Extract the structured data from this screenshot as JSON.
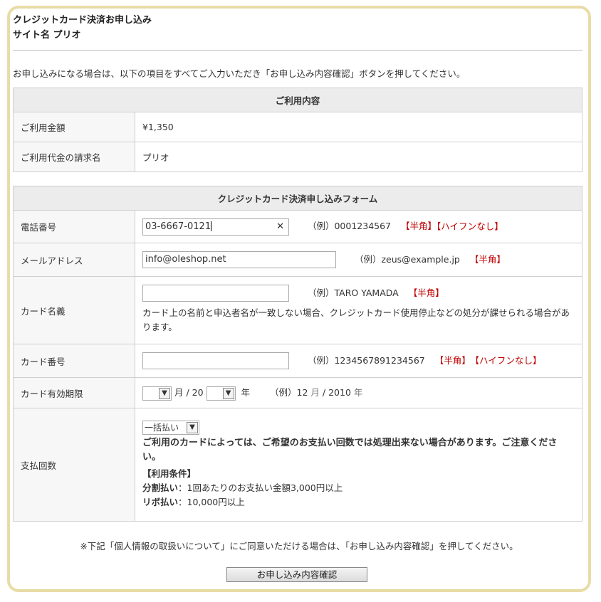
{
  "header": {
    "title": "クレジットカード決済お申し込み",
    "site": "サイト名 プリオ"
  },
  "intro": "お申し込みになる場合は、以下の項目をすべてご入力いただき「お申し込み内容確認」ボタンを押してください。",
  "usage": {
    "heading": "ご利用内容",
    "rows": [
      {
        "label": "ご利用金額",
        "value": "¥1,350"
      },
      {
        "label": "ご利用代金の請求名",
        "value": "プリオ"
      }
    ]
  },
  "form": {
    "heading": "クレジットカード決済申し込みフォーム",
    "phone": {
      "label": "電話番号",
      "value": "03-6667-0121",
      "clear": "✕",
      "example": "（例）0001234567",
      "tag1": "【半角】",
      "tag2": "【ハイフンなし】"
    },
    "email": {
      "label": "メールアドレス",
      "value": "info@oleshop.net",
      "example": "（例）zeus@example.jp",
      "tag1": "【半角】"
    },
    "cardname": {
      "label": "カード名義",
      "value": "",
      "example": "（例）TARO YAMADA",
      "tag1": "【半角】",
      "note": "カード上の名前と申込者名が一致しない場合、クレジットカード使用停止などの処分が課せられる場合があります。"
    },
    "cardnum": {
      "label": "カード番号",
      "value": "",
      "example": "（例）1234567891234567",
      "tag1": "【半角】",
      "tag2": "【ハイフンなし】"
    },
    "expiry": {
      "label": "カード有効期限",
      "month_sep": "月 / 20",
      "year_unit": "年",
      "example_prefix": "（例）12",
      "example_month": "月",
      "example_mid": "/ 2010",
      "example_year": "年"
    },
    "payment": {
      "label": "支払回数",
      "selected": "一括払い",
      "warning": "ご利用のカードによっては、ご希望のお支払い回数では処理出来ない場合があります。ご注意ください。",
      "cond_title": "【利用条件】",
      "cond1_bold": "分割払い",
      "cond1_rest": "：1回あたりのお支払い金額3,000円以上",
      "cond2_bold": "リボ払い",
      "cond2_rest": "：10,000円以上"
    }
  },
  "footer_note": "※下記「個人情報の取扱いについて」にご同意いただける場合は、「お申し込み内容確認」を押してください。",
  "submit_label": "お申し込み内容確認"
}
